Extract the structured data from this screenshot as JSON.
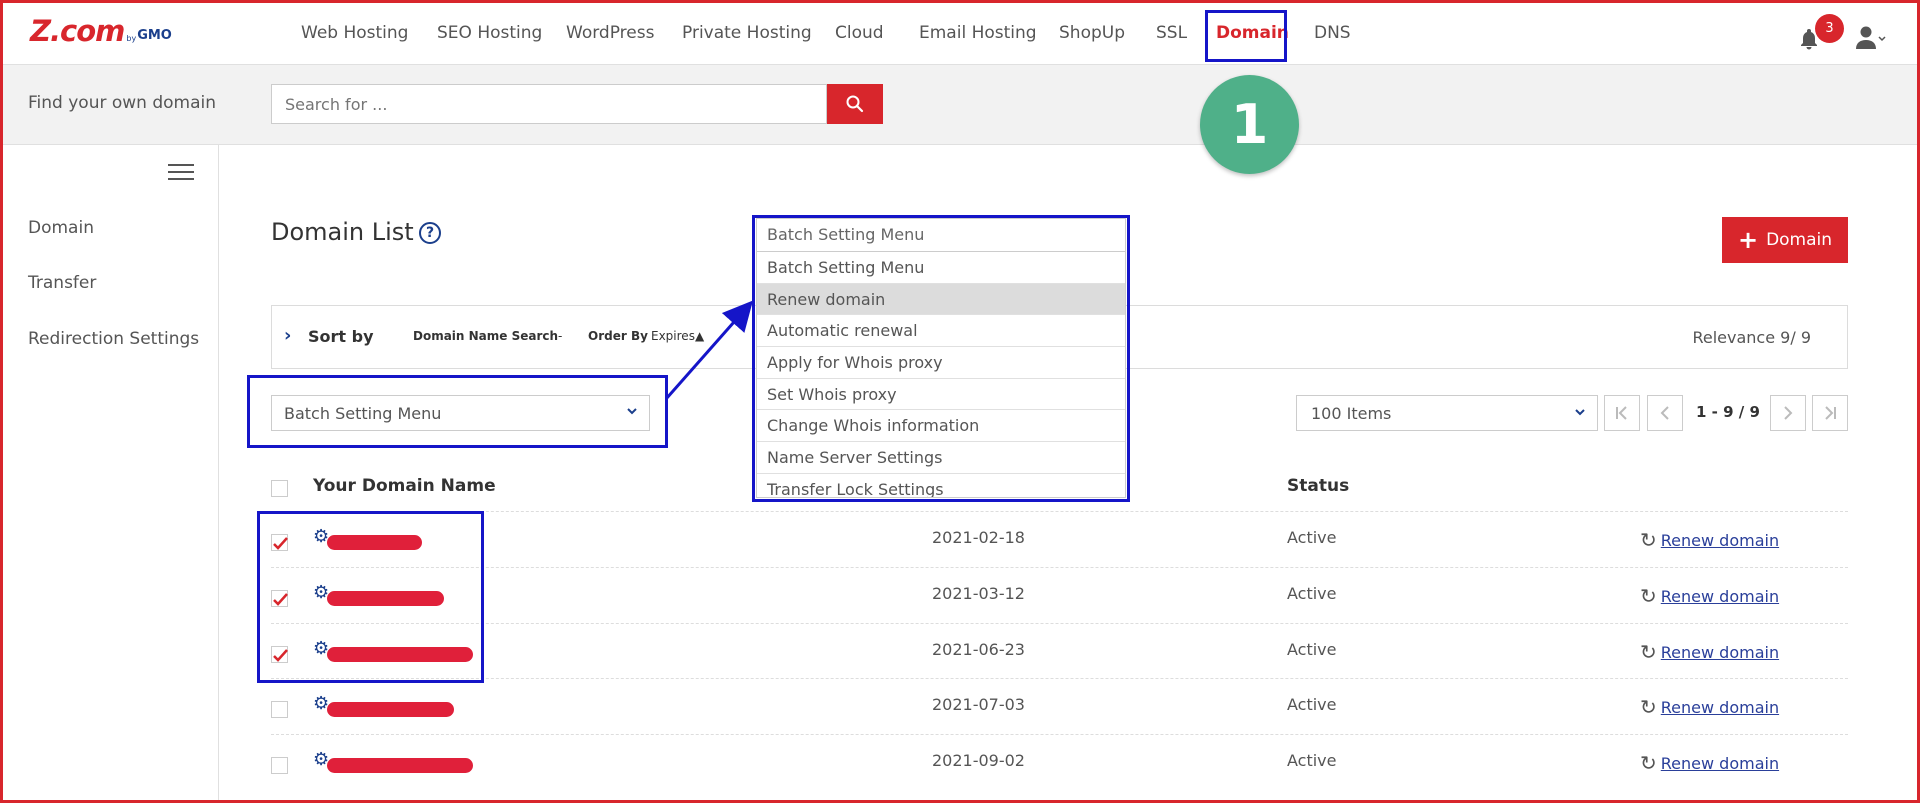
{
  "brand": {
    "logo": "Z.com",
    "by": "by",
    "gmo": "GMO"
  },
  "nav": {
    "items": [
      "Web Hosting",
      "SEO Hosting",
      "WordPress",
      "Private Hosting",
      "Cloud",
      "Email Hosting",
      "ShopUp",
      "SSL",
      "Domain",
      "DNS"
    ],
    "active": "Domain",
    "notifications": "3"
  },
  "search": {
    "label": "Find your own domain",
    "placeholder": "Search for ..."
  },
  "step_marker": "1",
  "sidebar": {
    "items": [
      "Domain",
      "Transfer",
      "Redirection Settings"
    ]
  },
  "main": {
    "title": "Domain List",
    "help": "?",
    "add_button": "Domain",
    "sort": {
      "label": "Sort by",
      "domain_search": "Domain Name Search",
      "dash": "-",
      "order_by": "Order By",
      "expires": "Expires▲",
      "relevance": "Relevance 9/ 9"
    },
    "batch_select": "Batch Setting Menu",
    "items_select": "100 Items",
    "pagination": "1 - 9 / 9"
  },
  "dropdown": {
    "header": "Batch Setting Menu",
    "options": [
      "Batch Setting Menu",
      "Renew domain",
      "Automatic renewal",
      "Apply for Whois proxy",
      "Set Whois proxy",
      "Change Whois information",
      "Name Server Settings",
      "Transfer Lock Settings"
    ],
    "selected": "Renew domain"
  },
  "table": {
    "headers": {
      "name": "Your Domain Name",
      "status": "Status"
    },
    "rows": [
      {
        "checked": true,
        "date": "2021-02-18",
        "status": "Active",
        "action": "Renew domain"
      },
      {
        "checked": true,
        "date": "2021-03-12",
        "status": "Active",
        "action": "Renew domain"
      },
      {
        "checked": true,
        "date": "2021-06-23",
        "status": "Active",
        "action": "Renew domain"
      },
      {
        "checked": false,
        "date": "2021-07-03",
        "status": "Active",
        "action": "Renew domain"
      },
      {
        "checked": false,
        "date": "2021-09-02",
        "status": "Active",
        "action": "Renew domain"
      }
    ]
  },
  "colors": {
    "brand_red": "#d8262c",
    "annotation_blue": "#1515c8",
    "step_green": "#4fb089",
    "link_blue": "#2a3f9a"
  }
}
